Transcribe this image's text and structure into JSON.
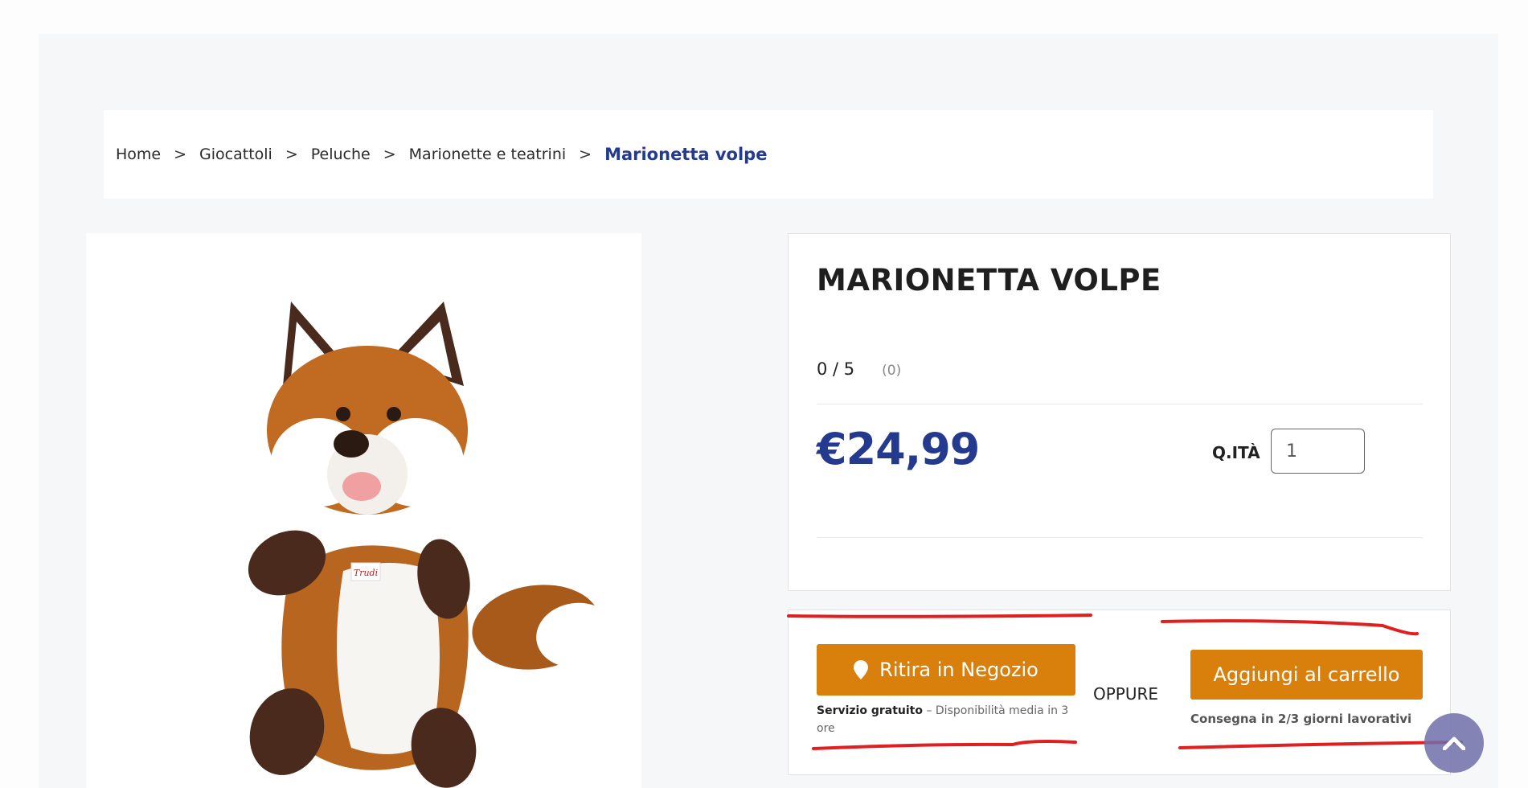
{
  "breadcrumb": {
    "items": [
      "Home",
      "Giocattoli",
      "Peluche",
      "Marionette e teatrini"
    ],
    "separator": ">",
    "current": "Marionetta volpe"
  },
  "product": {
    "image_label": "Trudi",
    "title": "MARIONETTA VOLPE",
    "rating_score": "0 / 5",
    "rating_count": "(0)",
    "price": "€24,99",
    "qty_label": "Q.ITÀ",
    "qty_value": "1"
  },
  "actions": {
    "store_button": "Ritira in Negozio",
    "store_note_bold": "Servizio gratuito",
    "store_note_rest": " – Disponibilità media in 3 ore",
    "or_label": "OPPURE",
    "cart_button": "Aggiungi al carrello",
    "cart_note": "Consegna in 2/3 giorni lavorativi"
  },
  "colors": {
    "accent_blue": "#233a8f",
    "button_orange": "#d9800c",
    "annotation_red": "#e02020",
    "scroll_button": "#6e6eaa"
  },
  "icons": {
    "store_button_icon": "map-pin-icon",
    "scroll_top_icon": "chevron-up-icon"
  }
}
